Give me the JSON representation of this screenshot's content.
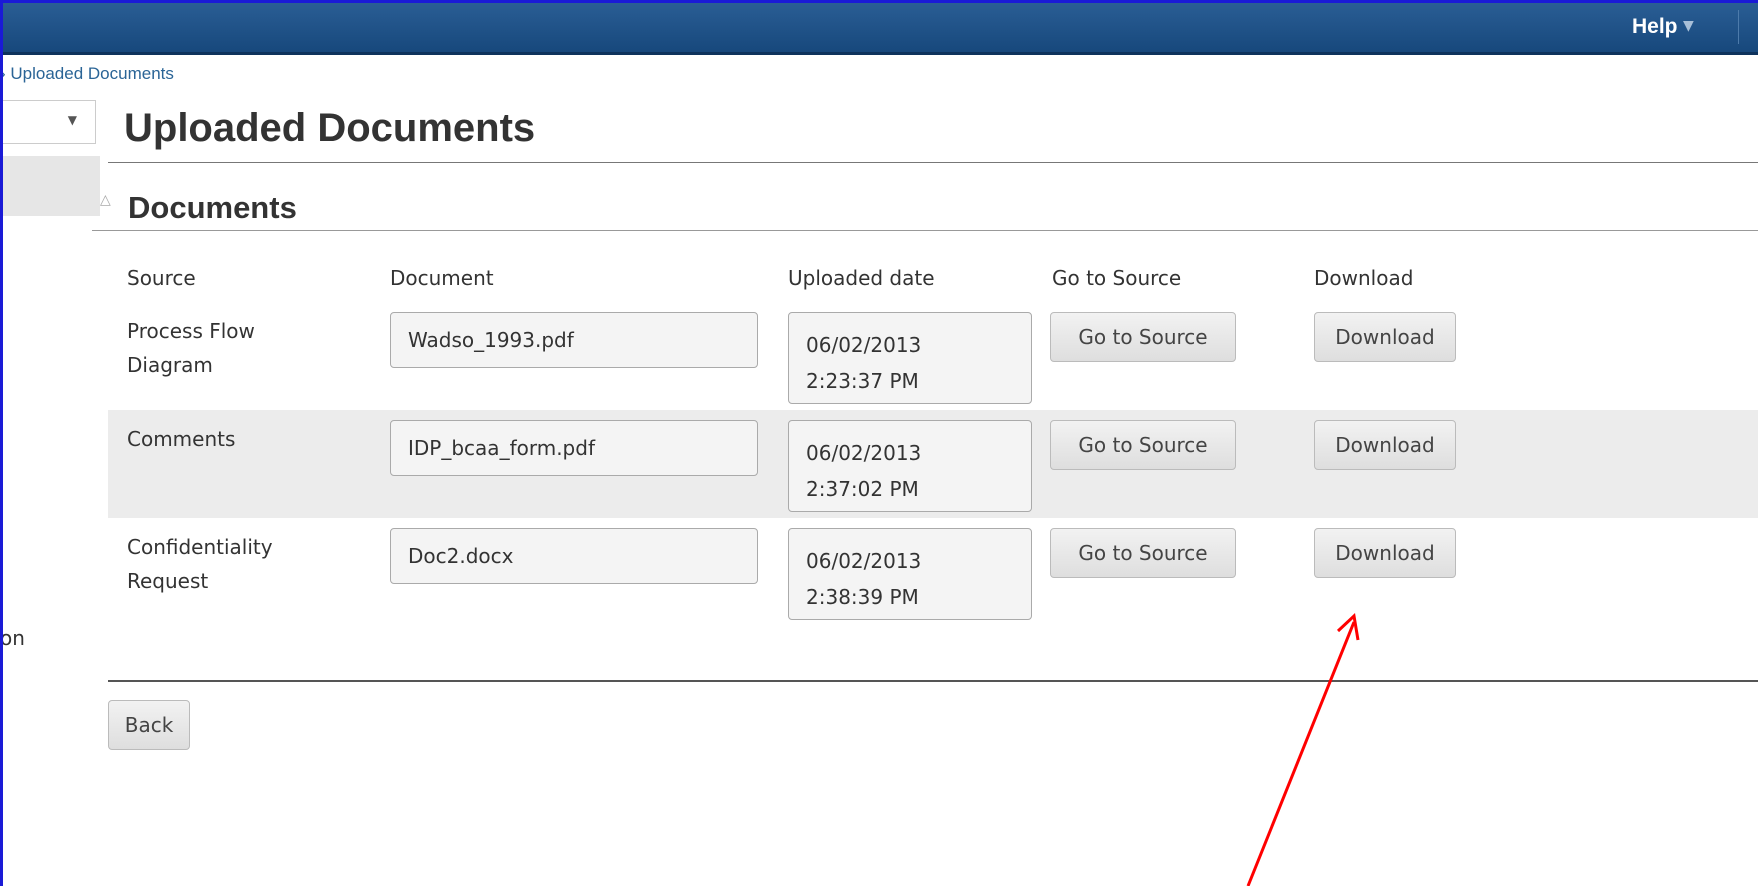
{
  "header": {
    "help_label": "Help",
    "help_caret": "▼"
  },
  "breadcrumb": {
    "text": "› Uploaded Documents"
  },
  "sidebar": {
    "partial_text": "on"
  },
  "page": {
    "title": "Uploaded Documents"
  },
  "section": {
    "toggle": "△",
    "title": "Documents"
  },
  "table": {
    "columns": [
      "Source",
      "Document",
      "Uploaded date",
      "Go to Source",
      "Download"
    ],
    "rows": [
      {
        "source_line1": "Process Flow",
        "source_line2": "Diagram",
        "document": "Wadso_1993.pdf",
        "date": "06/02/2013",
        "time": "2:23:37 PM",
        "go_label": "Go to Source",
        "download_label": "Download"
      },
      {
        "source_line1": "Comments",
        "source_line2": "",
        "document": "IDP_bcaa_form.pdf",
        "date": "06/02/2013",
        "time": "2:37:02 PM",
        "go_label": "Go to Source",
        "download_label": "Download"
      },
      {
        "source_line1": "Confidentiality",
        "source_line2": "Request",
        "document": "Doc2.docx",
        "date": "06/02/2013",
        "time": "2:38:39 PM",
        "go_label": "Go to Source",
        "download_label": "Download"
      }
    ]
  },
  "footer": {
    "back_label": "Back"
  },
  "colors": {
    "topbar": "#1f5389",
    "arrow": "#ff0000",
    "frame": "#1a1ad6"
  }
}
